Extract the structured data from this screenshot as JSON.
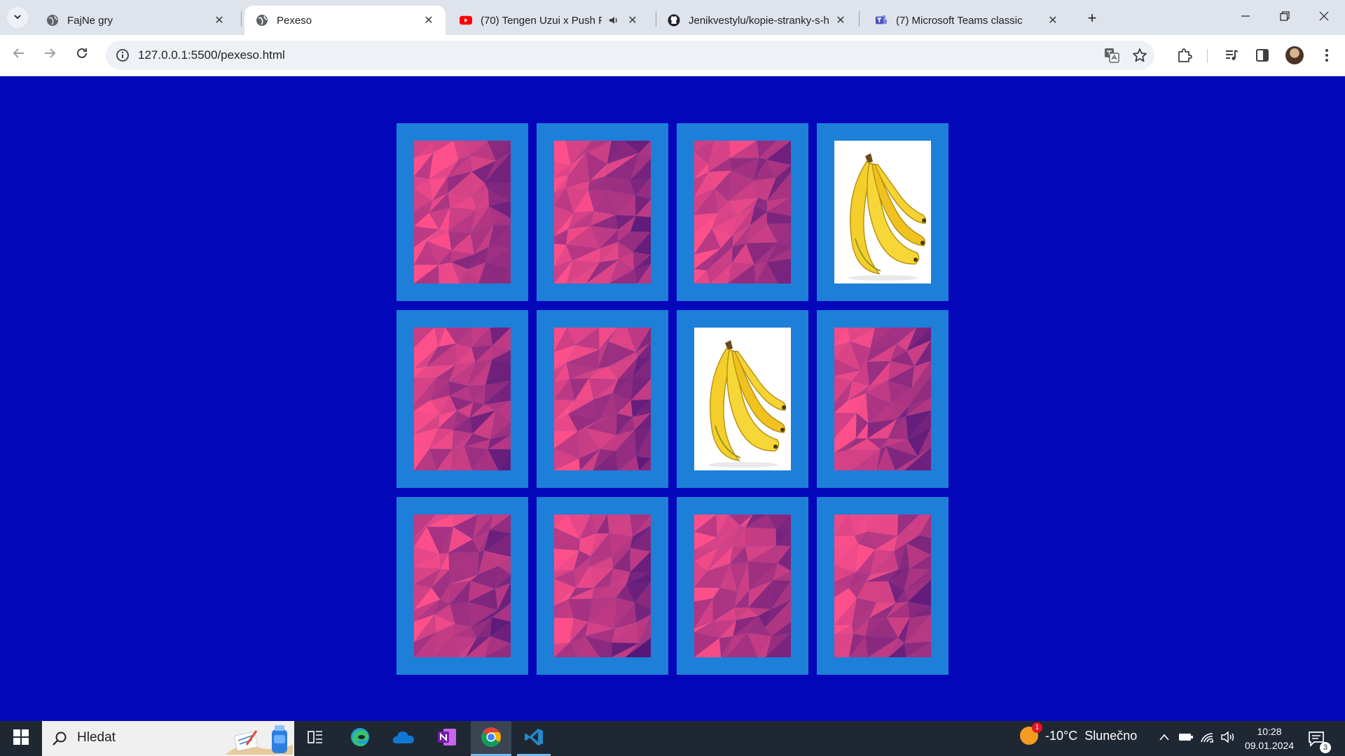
{
  "browser": {
    "tabs": [
      {
        "title": "FajNe gry",
        "favicon": "globe-icon",
        "active": false
      },
      {
        "title": "Pexeso",
        "favicon": "globe-icon",
        "active": true
      },
      {
        "title": "(70) Tengen Uzui x Push For",
        "favicon": "youtube-icon",
        "active": false,
        "audio": true
      },
      {
        "title": "Jenikvestylu/kopie-stranky-s-hr",
        "favicon": "github-icon",
        "active": false
      },
      {
        "title": "(7) Microsoft Teams classic",
        "favicon": "teams-icon",
        "active": false
      }
    ],
    "url": "127.0.0.1:5500/pexeso.html"
  },
  "colors": {
    "page_background": "#0407b9",
    "card_frame": "#1d7fd8",
    "card_back_light": "#ff4f8a",
    "card_back_dark": "#4a1478",
    "taskbar": "#1f2733"
  },
  "board": {
    "columns": 4,
    "rows": 3,
    "cards": [
      {
        "state": "back"
      },
      {
        "state": "back"
      },
      {
        "state": "back"
      },
      {
        "state": "flipped",
        "image": "banana"
      },
      {
        "state": "back"
      },
      {
        "state": "back"
      },
      {
        "state": "flipped",
        "image": "banana"
      },
      {
        "state": "back"
      },
      {
        "state": "back"
      },
      {
        "state": "back"
      },
      {
        "state": "back"
      },
      {
        "state": "back"
      }
    ]
  },
  "taskbar": {
    "search_placeholder": "Hledat",
    "apps": [
      {
        "name": "task-view-icon"
      },
      {
        "name": "edge-icon"
      },
      {
        "name": "onedrive-icon"
      },
      {
        "name": "onenote-icon"
      },
      {
        "name": "chrome-icon",
        "active": true
      },
      {
        "name": "vscode-icon",
        "open": true
      }
    ],
    "weather": {
      "temperature": "-10°C",
      "condition": "Slunečno",
      "alert_count": "1"
    },
    "time": "10:28",
    "date": "09.01.2024",
    "notification_count": "3"
  }
}
